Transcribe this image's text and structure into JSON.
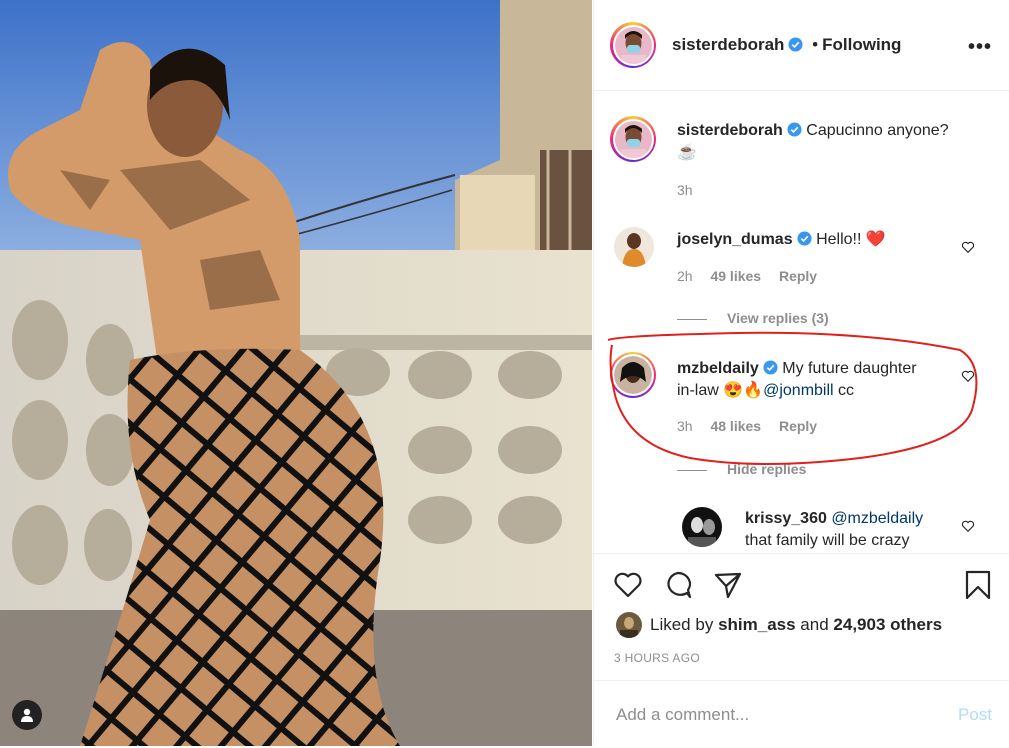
{
  "post_author": {
    "username": "sisterdeborah",
    "separator": "•",
    "follow_status": "Following",
    "more_label": "•••"
  },
  "caption": {
    "username": "sisterdeborah",
    "text": "Capucinno anyone?",
    "emoji": "☕",
    "time": "3h"
  },
  "comments": [
    {
      "username": "joselyn_dumas",
      "text": "Hello!!",
      "emoji": "❤️",
      "time": "2h",
      "likes": "49 likes",
      "reply_label": "Reply",
      "replies_toggle": "View replies (3)"
    },
    {
      "username": "mzbeldaily",
      "text_line1": "My future daughter",
      "text_line2": "in-law",
      "emoji": "😍🔥",
      "mention": "@jonmbill",
      "text_tail": "cc",
      "time": "3h",
      "likes": "48 likes",
      "reply_label": "Reply",
      "replies_toggle": "Hide replies"
    }
  ],
  "reply": {
    "username": "krissy_360",
    "mention": "@mzbeldaily",
    "text": "that family will be crazy"
  },
  "likes_summary": {
    "prefix": "Liked by",
    "user": "shim_ass",
    "middle": "and",
    "others": "24,903 others"
  },
  "posted_ago": "3 HOURS AGO",
  "comment_box": {
    "placeholder": "Add a comment...",
    "post_label": "Post"
  },
  "colors": {
    "verified_blue": "#3897f0",
    "mention_blue": "#00376b",
    "post_disabled": "#b3dbff",
    "annotation_red": "#e0201b"
  },
  "icons": [
    "heart-icon",
    "comment-icon",
    "share-icon",
    "bookmark-icon",
    "verified-icon",
    "user-tag-icon"
  ]
}
